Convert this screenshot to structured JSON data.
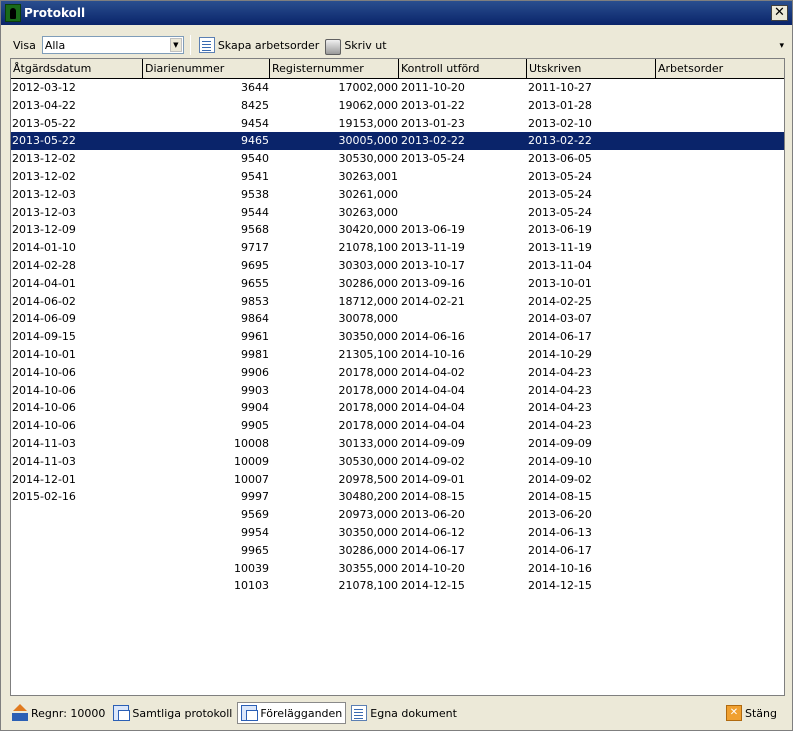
{
  "window": {
    "title": "Protokoll",
    "close_glyph": "✕"
  },
  "toolbar": {
    "visa_label": "Visa",
    "visa_value": "Alla",
    "create_order_label": "Skapa arbetsorder",
    "print_label": "Skriv ut",
    "overflow_glyph": "▾"
  },
  "table": {
    "columns": [
      "Åtgärdsdatum",
      "Diarienummer",
      "Registernummer",
      "Kontroll utförd",
      "Utskriven",
      "Arbetsorder"
    ],
    "selected_row": 3,
    "rows": [
      [
        "2012-03-12",
        "3644",
        "17002,000",
        "2011-10-20",
        "2011-10-27",
        ""
      ],
      [
        "2013-04-22",
        "8425",
        "19062,000",
        "2013-01-22",
        "2013-01-28",
        ""
      ],
      [
        "2013-05-22",
        "9454",
        "19153,000",
        "2013-01-23",
        "2013-02-10",
        ""
      ],
      [
        "2013-05-22",
        "9465",
        "30005,000",
        "2013-02-22",
        "2013-02-22",
        ""
      ],
      [
        "2013-12-02",
        "9540",
        "30530,000",
        "2013-05-24",
        "2013-06-05",
        ""
      ],
      [
        "2013-12-02",
        "9541",
        "30263,001",
        "",
        "2013-05-24",
        ""
      ],
      [
        "2013-12-03",
        "9538",
        "30261,000",
        "",
        "2013-05-24",
        ""
      ],
      [
        "2013-12-03",
        "9544",
        "30263,000",
        "",
        "2013-05-24",
        ""
      ],
      [
        "2013-12-09",
        "9568",
        "30420,000",
        "2013-06-19",
        "2013-06-19",
        ""
      ],
      [
        "2014-01-10",
        "9717",
        "21078,100",
        "2013-11-19",
        "2013-11-19",
        ""
      ],
      [
        "2014-02-28",
        "9695",
        "30303,000",
        "2013-10-17",
        "2013-11-04",
        ""
      ],
      [
        "2014-04-01",
        "9655",
        "30286,000",
        "2013-09-16",
        "2013-10-01",
        ""
      ],
      [
        "2014-06-02",
        "9853",
        "18712,000",
        "2014-02-21",
        "2014-02-25",
        ""
      ],
      [
        "2014-06-09",
        "9864",
        "30078,000",
        "",
        "2014-03-07",
        ""
      ],
      [
        "2014-09-15",
        "9961",
        "30350,000",
        "2014-06-16",
        "2014-06-17",
        ""
      ],
      [
        "2014-10-01",
        "9981",
        "21305,100",
        "2014-10-16",
        "2014-10-29",
        ""
      ],
      [
        "2014-10-06",
        "9906",
        "20178,000",
        "2014-04-02",
        "2014-04-23",
        ""
      ],
      [
        "2014-10-06",
        "9903",
        "20178,000",
        "2014-04-04",
        "2014-04-23",
        ""
      ],
      [
        "2014-10-06",
        "9904",
        "20178,000",
        "2014-04-04",
        "2014-04-23",
        ""
      ],
      [
        "2014-10-06",
        "9905",
        "20178,000",
        "2014-04-04",
        "2014-04-23",
        ""
      ],
      [
        "2014-11-03",
        "10008",
        "30133,000",
        "2014-09-09",
        "2014-09-09",
        ""
      ],
      [
        "2014-11-03",
        "10009",
        "30530,000",
        "2014-09-02",
        "2014-09-10",
        ""
      ],
      [
        "2014-12-01",
        "10007",
        "20978,500",
        "2014-09-01",
        "2014-09-02",
        ""
      ],
      [
        "2015-02-16",
        "9997",
        "30480,200",
        "2014-08-15",
        "2014-08-15",
        ""
      ],
      [
        "",
        "9569",
        "20973,000",
        "2013-06-20",
        "2013-06-20",
        ""
      ],
      [
        "",
        "9954",
        "30350,000",
        "2014-06-12",
        "2014-06-13",
        ""
      ],
      [
        "",
        "9965",
        "30286,000",
        "2014-06-17",
        "2014-06-17",
        ""
      ],
      [
        "",
        "10039",
        "30355,000",
        "2014-10-20",
        "2014-10-16",
        ""
      ],
      [
        "",
        "10103",
        "21078,100",
        "2014-12-15",
        "2014-12-15",
        ""
      ]
    ]
  },
  "statusbar": {
    "regnr_label": "Regnr: 10000",
    "all_protocols_label": "Samtliga protokoll",
    "orders_label": "Förelägganden",
    "own_documents_label": "Egna dokument",
    "close_label": "Stäng"
  },
  "colors": {
    "selection": "#0a246a",
    "titlebar": "#0a246a",
    "chrome": "#ece9d8"
  }
}
